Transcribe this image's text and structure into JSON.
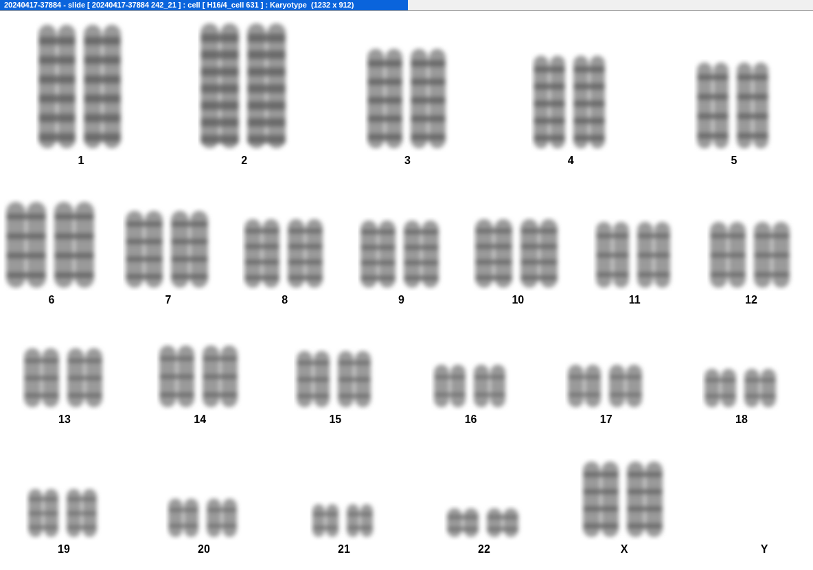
{
  "window": {
    "title": "20240417-37884 - slide [ 20240417-37884 242_21 ] : cell [ H16/4_cell 631 ] : Karyotype  (1232 x 912)"
  },
  "karyotype": {
    "rows": [
      {
        "pairs": [
          {
            "label": "1",
            "empty": false
          },
          {
            "label": "2",
            "empty": false
          },
          {
            "label": "3",
            "empty": false
          },
          {
            "label": "4",
            "empty": false
          },
          {
            "label": "5",
            "empty": false
          }
        ]
      },
      {
        "pairs": [
          {
            "label": "6",
            "empty": false
          },
          {
            "label": "7",
            "empty": false
          },
          {
            "label": "8",
            "empty": false
          },
          {
            "label": "9",
            "empty": false
          },
          {
            "label": "10",
            "empty": false
          },
          {
            "label": "11",
            "empty": false
          },
          {
            "label": "12",
            "empty": false
          }
        ]
      },
      {
        "pairs": [
          {
            "label": "13",
            "empty": false
          },
          {
            "label": "14",
            "empty": false
          },
          {
            "label": "15",
            "empty": false
          },
          {
            "label": "16",
            "empty": false
          },
          {
            "label": "17",
            "empty": false
          },
          {
            "label": "18",
            "empty": false
          }
        ]
      },
      {
        "pairs": [
          {
            "label": "19",
            "empty": false
          },
          {
            "label": "20",
            "empty": false
          },
          {
            "label": "21",
            "empty": false
          },
          {
            "label": "22",
            "empty": false
          },
          {
            "label": "X",
            "empty": false
          },
          {
            "label": "Y",
            "empty": true
          }
        ]
      }
    ]
  }
}
